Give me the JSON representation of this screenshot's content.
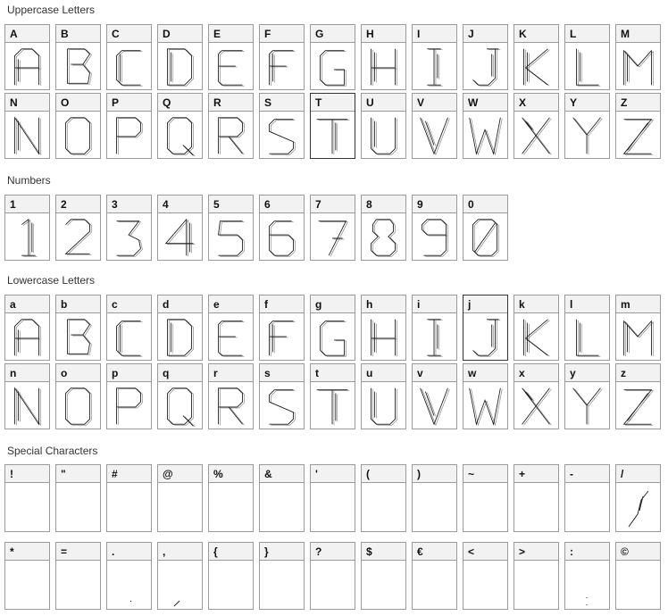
{
  "sections": {
    "uppercase": {
      "title": "Uppercase Letters",
      "rows": [
        [
          "A",
          "B",
          "C",
          "D",
          "E",
          "F",
          "G",
          "H",
          "I",
          "J",
          "K",
          "L",
          "M"
        ],
        [
          "N",
          "O",
          "P",
          "Q",
          "R",
          "S",
          "T",
          "U",
          "V",
          "W",
          "X",
          "Y",
          "Z"
        ]
      ]
    },
    "numbers": {
      "title": "Numbers",
      "rows": [
        [
          "1",
          "2",
          "3",
          "4",
          "5",
          "6",
          "7",
          "8",
          "9",
          "0"
        ]
      ]
    },
    "lowercase": {
      "title": "Lowercase Letters",
      "rows": [
        [
          "a",
          "b",
          "c",
          "d",
          "e",
          "f",
          "g",
          "h",
          "i",
          "j",
          "k",
          "l",
          "m"
        ],
        [
          "n",
          "o",
          "p",
          "q",
          "r",
          "s",
          "t",
          "u",
          "v",
          "w",
          "x",
          "y",
          "z"
        ]
      ]
    },
    "special": {
      "title": "Special Characters",
      "rows": [
        [
          "!",
          "\"",
          "#",
          "@",
          "%",
          "&",
          "'",
          "(",
          ")",
          "~",
          "+",
          "-",
          "/"
        ],
        [
          "*",
          "=",
          ".",
          ",",
          "{",
          "}",
          "?",
          "$",
          "€",
          "<",
          ">",
          ":",
          "©"
        ]
      ]
    }
  },
  "colors": {
    "stroke": "#1a1a1a",
    "border": "#9a9a9a",
    "header_bg": "#f2f2f2"
  }
}
